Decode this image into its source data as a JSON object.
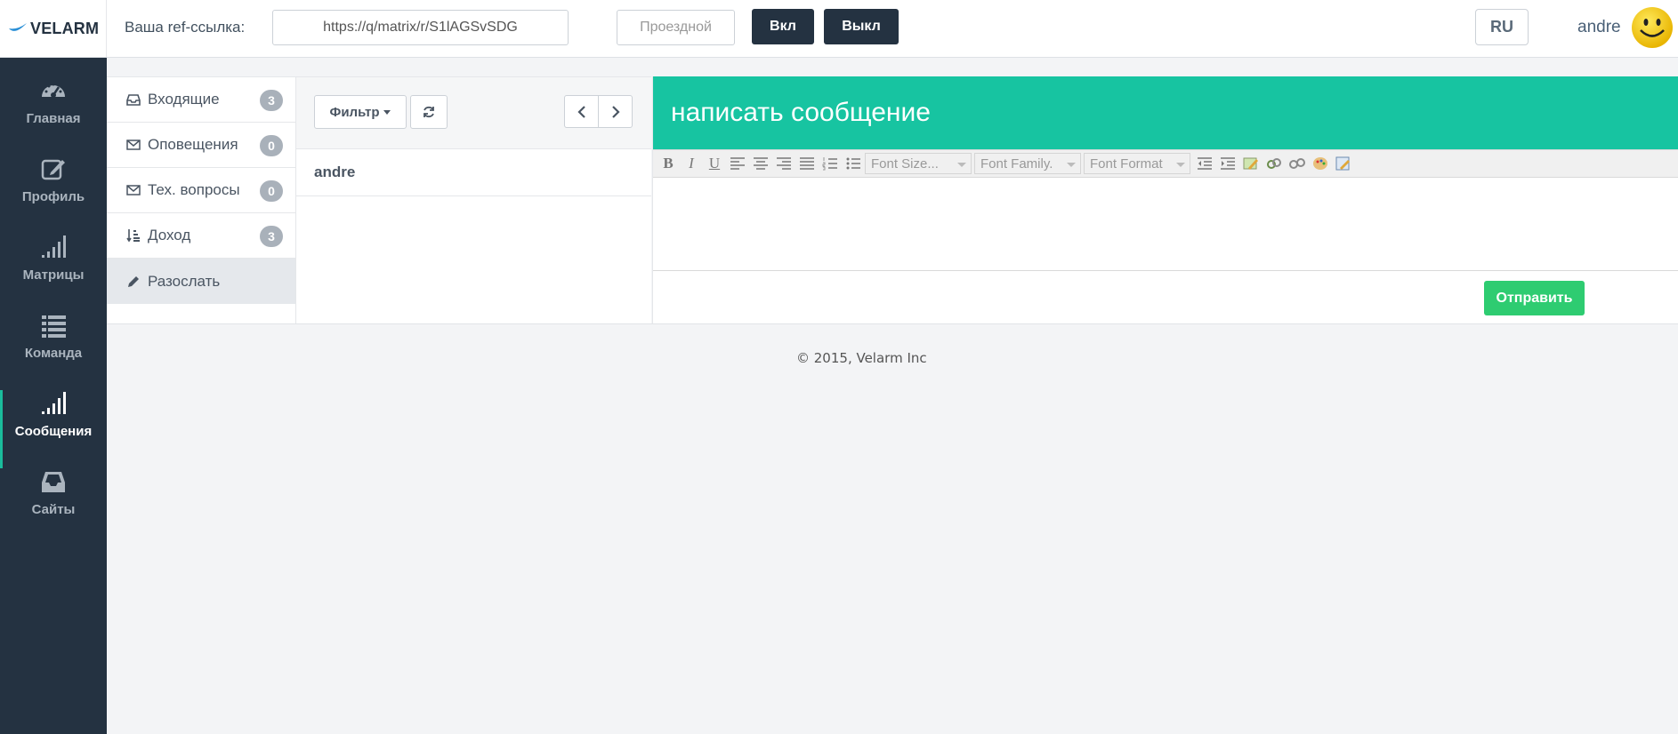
{
  "brand": {
    "name": "VELARM"
  },
  "topbar": {
    "ref_label": "Ваша ref-ссылка:",
    "ref_value": "https://q/matrix/r/S1lAGSvSDG",
    "pass_label": "Проездной",
    "on_label": "Вкл",
    "off_label": "Выкл",
    "language": "RU",
    "username": "andre"
  },
  "sidebar": {
    "items": [
      {
        "label": "Главная",
        "icon": "dashboard-icon"
      },
      {
        "label": "Профиль",
        "icon": "edit-profile-icon"
      },
      {
        "label": "Матрицы",
        "icon": "signal-bars-icon"
      },
      {
        "label": "Команда",
        "icon": "list-icon"
      },
      {
        "label": "Сообщения",
        "icon": "signal-bars-icon",
        "active": true
      },
      {
        "label": "Сайты",
        "icon": "inbox-icon"
      }
    ]
  },
  "mailnav": {
    "items": [
      {
        "label": "Входящие",
        "count": "3",
        "icon": "inbox-icon"
      },
      {
        "label": "Оповещения",
        "count": "0",
        "icon": "envelope-icon"
      },
      {
        "label": "Тех. вопросы",
        "count": "0",
        "icon": "envelope-icon"
      },
      {
        "label": "Доход",
        "count": "3",
        "icon": "sort-icon"
      },
      {
        "label": "Разослать",
        "icon": "pencil-icon",
        "active": true
      }
    ]
  },
  "msglist": {
    "filter_label": "Фильтр",
    "sender": "andre"
  },
  "compose": {
    "title": "написать сообщение",
    "toolbar": {
      "bold": "B",
      "italic": "I",
      "underline": "U",
      "font_size": "Font Size...",
      "font_family": "Font Family.",
      "font_format": "Font Format"
    },
    "send_label": "Отправить"
  },
  "footer": {
    "text": "© 2015, Velarm Inc"
  },
  "colors": {
    "sidebar": "#243241",
    "accent": "#17c4a1",
    "send": "#2ecc71"
  }
}
